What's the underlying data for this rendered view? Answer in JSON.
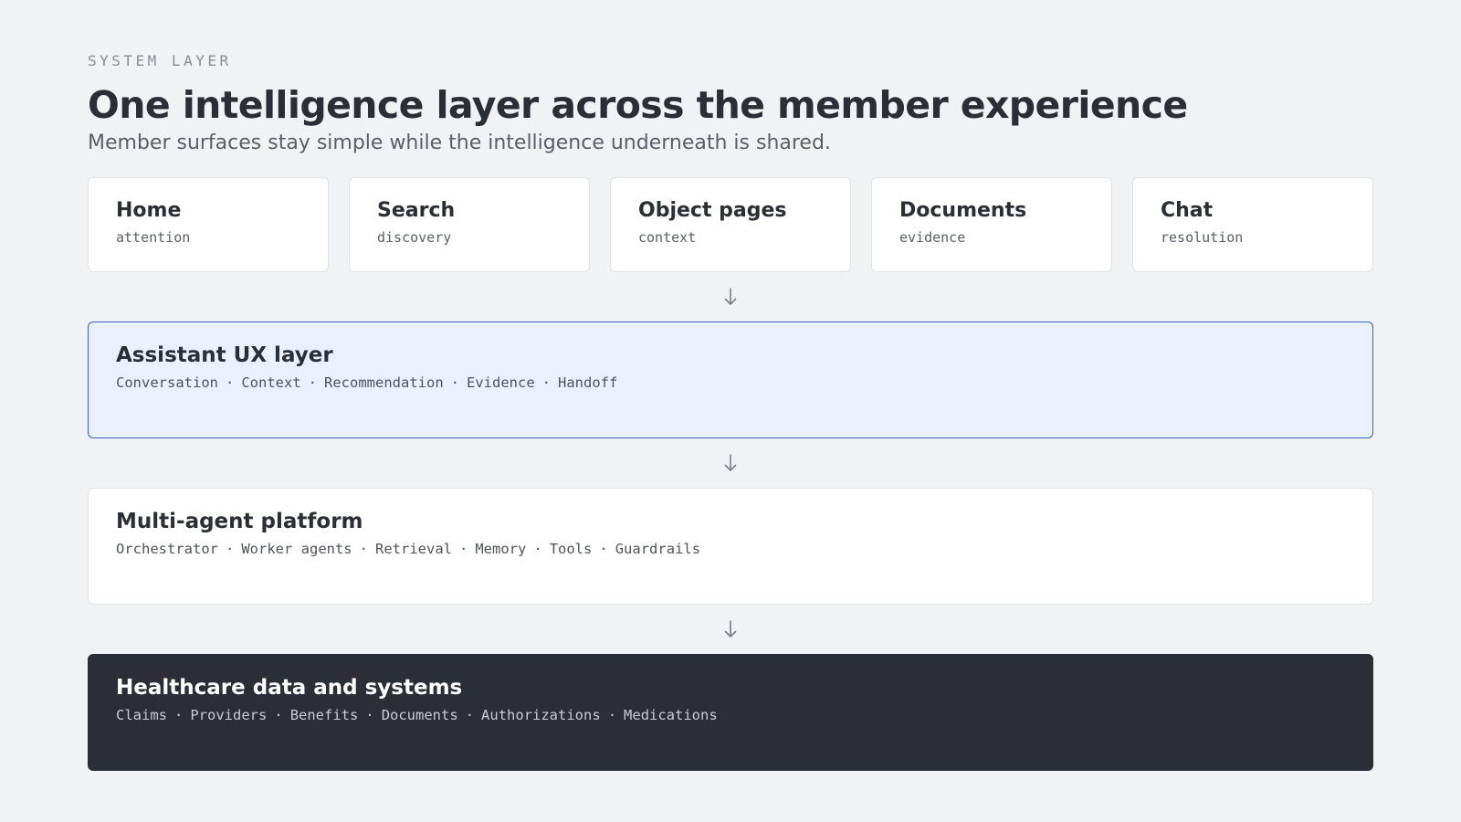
{
  "header": {
    "eyebrow": "SYSTEM LAYER",
    "title": "One intelligence layer across the member experience",
    "subtitle": "Member surfaces stay simple while the intelligence underneath is shared."
  },
  "surfaces": [
    {
      "title": "Home",
      "sub": "attention"
    },
    {
      "title": "Search",
      "sub": "discovery"
    },
    {
      "title": "Object pages",
      "sub": "context"
    },
    {
      "title": "Documents",
      "sub": "evidence"
    },
    {
      "title": "Chat",
      "sub": "resolution"
    }
  ],
  "arrow_icon": "arrow-down-icon",
  "separator": "·",
  "layers": {
    "assistant": {
      "title": "Assistant UX layer",
      "items": [
        "Conversation",
        "Context",
        "Recommendation",
        "Evidence",
        "Handoff"
      ]
    },
    "platform": {
      "title": "Multi-agent platform",
      "items": [
        "Orchestrator",
        "Worker agents",
        "Retrieval",
        "Memory",
        "Tools",
        "Guardrails"
      ]
    },
    "data": {
      "title": "Healthcare data and systems",
      "items": [
        "Claims",
        "Providers",
        "Benefits",
        "Documents",
        "Authorizations",
        "Medications"
      ]
    }
  },
  "colors": {
    "background": "#f1f2f4",
    "assistant_fill": "#ebf0fd",
    "assistant_border": "#3f5fbf",
    "data_fill": "#2b2e36"
  }
}
